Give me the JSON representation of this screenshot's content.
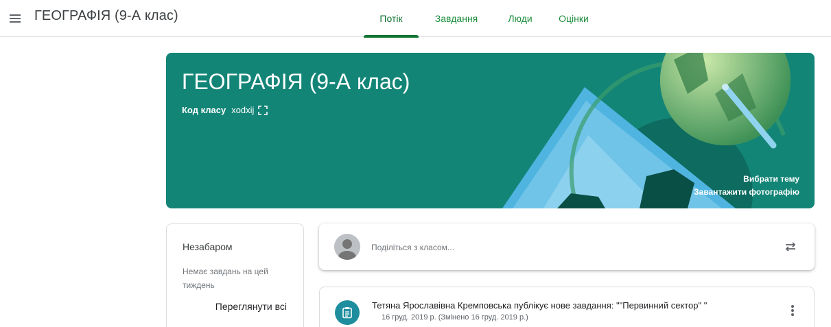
{
  "header": {
    "menu_icon": "hamburger-menu-icon",
    "title": "ГЕОГРАФІЯ (9-А клас)",
    "tabs": [
      {
        "label": "Потік",
        "active": true
      },
      {
        "label": "Завдання",
        "active": false
      },
      {
        "label": "Люди",
        "active": false
      },
      {
        "label": "Оцінки",
        "active": false
      }
    ]
  },
  "banner": {
    "title": "ГЕОГРАФІЯ (9-А клас)",
    "class_code_label": "Код класу",
    "class_code_value": "xodxij",
    "fullscreen_icon": "fullscreen-icon",
    "select_theme": "Вибрати тему",
    "upload_photo": "Завантажити фотографію",
    "color": "#138577"
  },
  "upcoming": {
    "title": "Незабаром",
    "text": "Немає завдань на цей тиждень",
    "view_all": "Переглянути всі"
  },
  "share": {
    "placeholder": "Поділіться з класом...",
    "icon": "repost-icon"
  },
  "post": {
    "title": "Тетяна Ярославівна Кремповська публікує нове завдання: \"\"Первинний сектор\" \"",
    "date": "16 груд. 2019 р. (Змінено 16 груд. 2019 р.)",
    "icon": "assignment-icon"
  }
}
